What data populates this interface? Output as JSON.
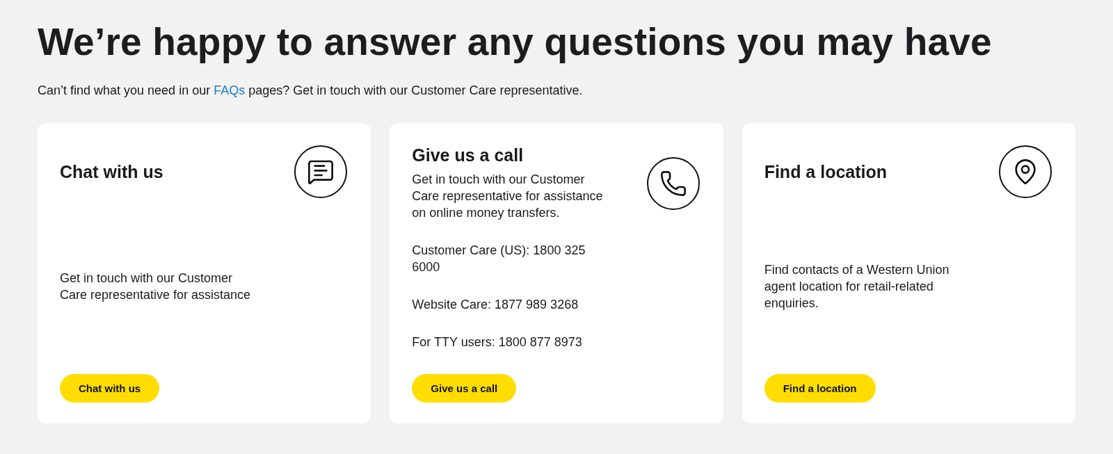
{
  "heading": "We’re happy to answer any questions you may have",
  "intro": {
    "before": "Can’t find what you need in our",
    "link": "FAQs",
    "after": "pages? Get in touch with our Customer Care representative."
  },
  "cards": [
    {
      "kind": "chat",
      "title": "Chat with us",
      "paragraphs": [
        "Get in touch with our Customer Care representative for assistance"
      ],
      "button": "Chat with us"
    },
    {
      "kind": "phone",
      "title": "Give us a call",
      "lead": "Get in touch with our Customer Care representative for assistance on online money transfers.",
      "paragraphs": [
        "Customer Care (US): 1800 325 6000",
        "Website Care: 1877 989 3268",
        "For TTY users: 1800 877 8973"
      ],
      "button": "Give us a call"
    },
    {
      "kind": "location",
      "title": "Find a location",
      "paragraphs": [
        "Find contacts of a Western Union agent location for retail-related enquiries."
      ],
      "button": "Find a location"
    }
  ]
}
